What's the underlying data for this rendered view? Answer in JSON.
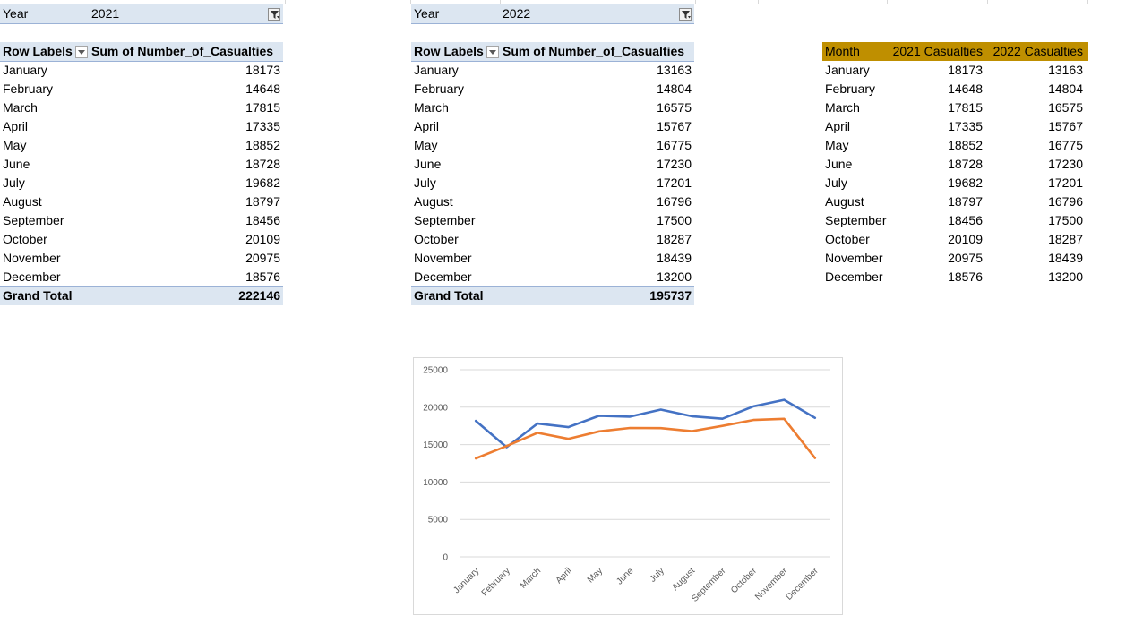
{
  "pivot_2021": {
    "filter_label": "Year",
    "filter_value": "2021",
    "header_row_labels": "Row Labels",
    "header_sum": "Sum of Number_of_Casualties",
    "rows": [
      {
        "month": "January",
        "value": "18173"
      },
      {
        "month": "February",
        "value": "14648"
      },
      {
        "month": "March",
        "value": "17815"
      },
      {
        "month": "April",
        "value": "17335"
      },
      {
        "month": "May",
        "value": "18852"
      },
      {
        "month": "June",
        "value": "18728"
      },
      {
        "month": "July",
        "value": "19682"
      },
      {
        "month": "August",
        "value": "18797"
      },
      {
        "month": "September",
        "value": "18456"
      },
      {
        "month": "October",
        "value": "20109"
      },
      {
        "month": "November",
        "value": "20975"
      },
      {
        "month": "December",
        "value": "18576"
      }
    ],
    "grand_total_label": "Grand Total",
    "grand_total_value": "222146"
  },
  "pivot_2022": {
    "filter_label": "Year",
    "filter_value": "2022",
    "header_row_labels": "Row Labels",
    "header_sum": "Sum of Number_of_Casualties",
    "rows": [
      {
        "month": "January",
        "value": "13163"
      },
      {
        "month": "February",
        "value": "14804"
      },
      {
        "month": "March",
        "value": "16575"
      },
      {
        "month": "April",
        "value": "15767"
      },
      {
        "month": "May",
        "value": "16775"
      },
      {
        "month": "June",
        "value": "17230"
      },
      {
        "month": "July",
        "value": "17201"
      },
      {
        "month": "August",
        "value": "16796"
      },
      {
        "month": "September",
        "value": "17500"
      },
      {
        "month": "October",
        "value": "18287"
      },
      {
        "month": "November",
        "value": "18439"
      },
      {
        "month": "December",
        "value": "13200"
      }
    ],
    "grand_total_label": "Grand Total",
    "grand_total_value": "195737"
  },
  "comparison_table": {
    "headers": [
      "Month",
      "2021 Casualties",
      "2022 Casualties"
    ],
    "rows": [
      [
        "January",
        "18173",
        "13163"
      ],
      [
        "February",
        "14648",
        "14804"
      ],
      [
        "March",
        "17815",
        "16575"
      ],
      [
        "April",
        "17335",
        "15767"
      ],
      [
        "May",
        "18852",
        "16775"
      ],
      [
        "June",
        "18728",
        "17230"
      ],
      [
        "July",
        "19682",
        "17201"
      ],
      [
        "August",
        "18797",
        "16796"
      ],
      [
        "September",
        "18456",
        "17500"
      ],
      [
        "October",
        "20109",
        "18287"
      ],
      [
        "November",
        "20975",
        "18439"
      ],
      [
        "December",
        "18576",
        "13200"
      ]
    ],
    "header_color": "#bf8f00"
  },
  "colors": {
    "pivot_header_fill": "#dce6f1",
    "series_2021": "#4472c4",
    "series_2022": "#ed7d31",
    "gridline": "#d9d9d9"
  },
  "chart_data": {
    "type": "line",
    "categories": [
      "January",
      "February",
      "March",
      "April",
      "May",
      "June",
      "July",
      "August",
      "September",
      "October",
      "November",
      "December"
    ],
    "series": [
      {
        "color": "#4472c4",
        "values": [
          18173,
          14648,
          17815,
          17335,
          18852,
          18728,
          19682,
          18797,
          18456,
          20109,
          20975,
          18576
        ]
      },
      {
        "color": "#ed7d31",
        "values": [
          13163,
          14804,
          16575,
          15767,
          16775,
          17230,
          17201,
          16796,
          17500,
          18287,
          18439,
          13200
        ]
      }
    ],
    "ylim": [
      0,
      25000
    ],
    "yticks": [
      "0",
      "5000",
      "10000",
      "15000",
      "20000",
      "25000"
    ],
    "grid": true,
    "legend": "none"
  }
}
